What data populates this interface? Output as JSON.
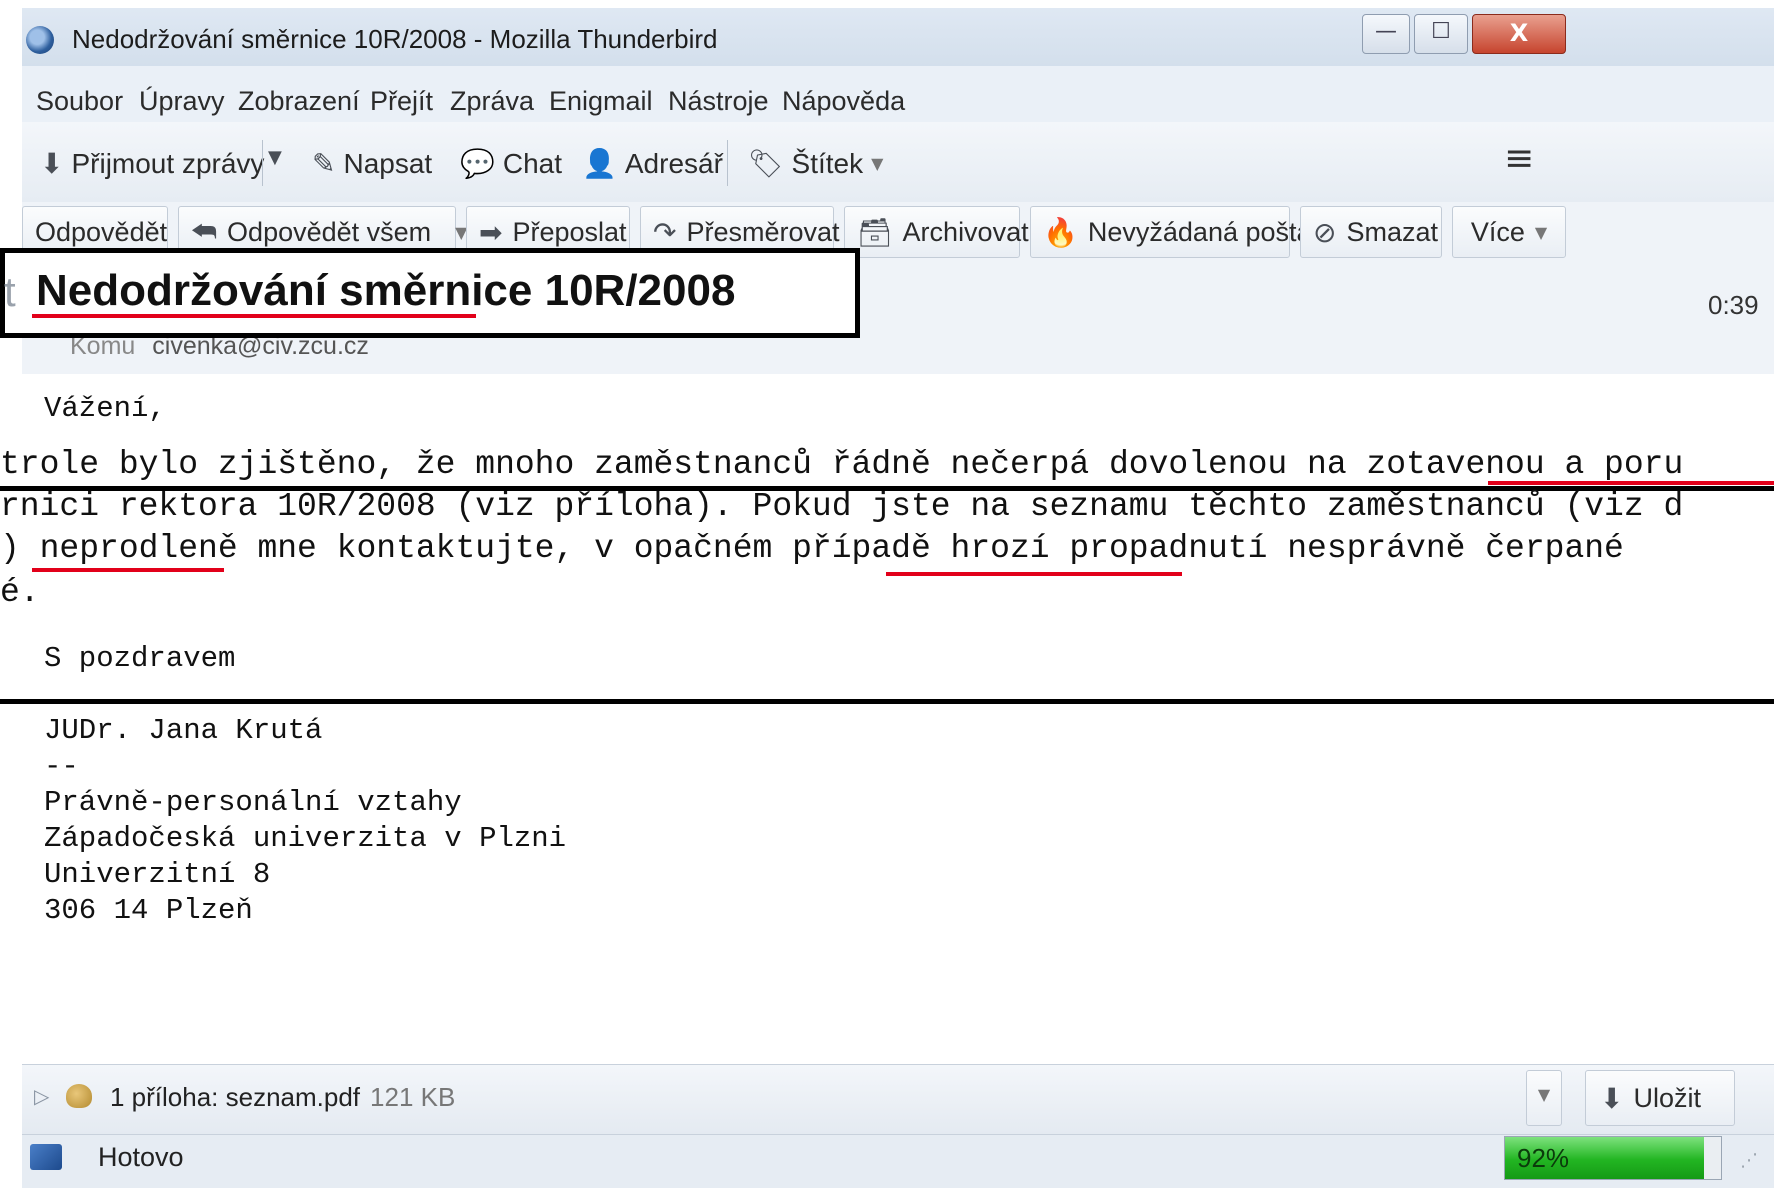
{
  "window": {
    "title": "Nedodržování směrnice 10R/2008 - Mozilla Thunderbird",
    "controls": {
      "minimize": "—",
      "maximize": "☐",
      "close": "X"
    }
  },
  "menu": [
    "Soubor",
    "Úpravy",
    "Zobrazení",
    "Přejít",
    "Zpráva",
    "Enigmail",
    "Nástroje",
    "Nápověda"
  ],
  "toolbar": {
    "get_mail": "Přijmout zprávy",
    "write": "Napsat",
    "chat": "Chat",
    "address_book": "Adresář",
    "tag": "Štítek"
  },
  "message_actions": {
    "reply": "Odpovědět",
    "reply_all": "Odpovědět všem",
    "forward": "Přeposlat",
    "redirect": "Přesměrovat",
    "archive": "Archivovat",
    "junk": "Nevyžádaná pošta",
    "delete": "Smazat",
    "more": "Více"
  },
  "header": {
    "subject_prefix": "t",
    "subject": "Nedodržování směrnice 10R/2008",
    "to_label": "Komu",
    "to_value": "civenka@civ.zcu.cz",
    "time": "0:39"
  },
  "body": {
    "greeting": "Vážení,",
    "lines": [
      "trole bylo zjištěno, že mnoho zaměstnanců řádně nečerpá dovolenou na zotavenou a poru",
      "rnici rektora 10R/2008 (viz příloha). Pokud jste na seznamu těchto zaměstnanců (viz d",
      ") neprodleně mne kontaktujte, v opačném případě hrozí propadnutí nesprávně čerpané",
      "é."
    ],
    "closing": "S pozdravem",
    "signature": [
      "JUDr. Jana Krutá",
      "--",
      "Právně-personální vztahy",
      "Západočeská univerzita v Plzni",
      "Univerzitní 8",
      "306 14 Plzeň"
    ]
  },
  "attachment": {
    "summary": "1 příloha: seznam.pdf",
    "size": "121 KB",
    "save": "Uložit"
  },
  "status": {
    "text": "Hotovo",
    "progress_label": "92%",
    "progress": 0.92
  },
  "colors": {
    "highlight_underline": "#e2001a",
    "progress_green": "#22b522",
    "frame_border": "#000000"
  }
}
